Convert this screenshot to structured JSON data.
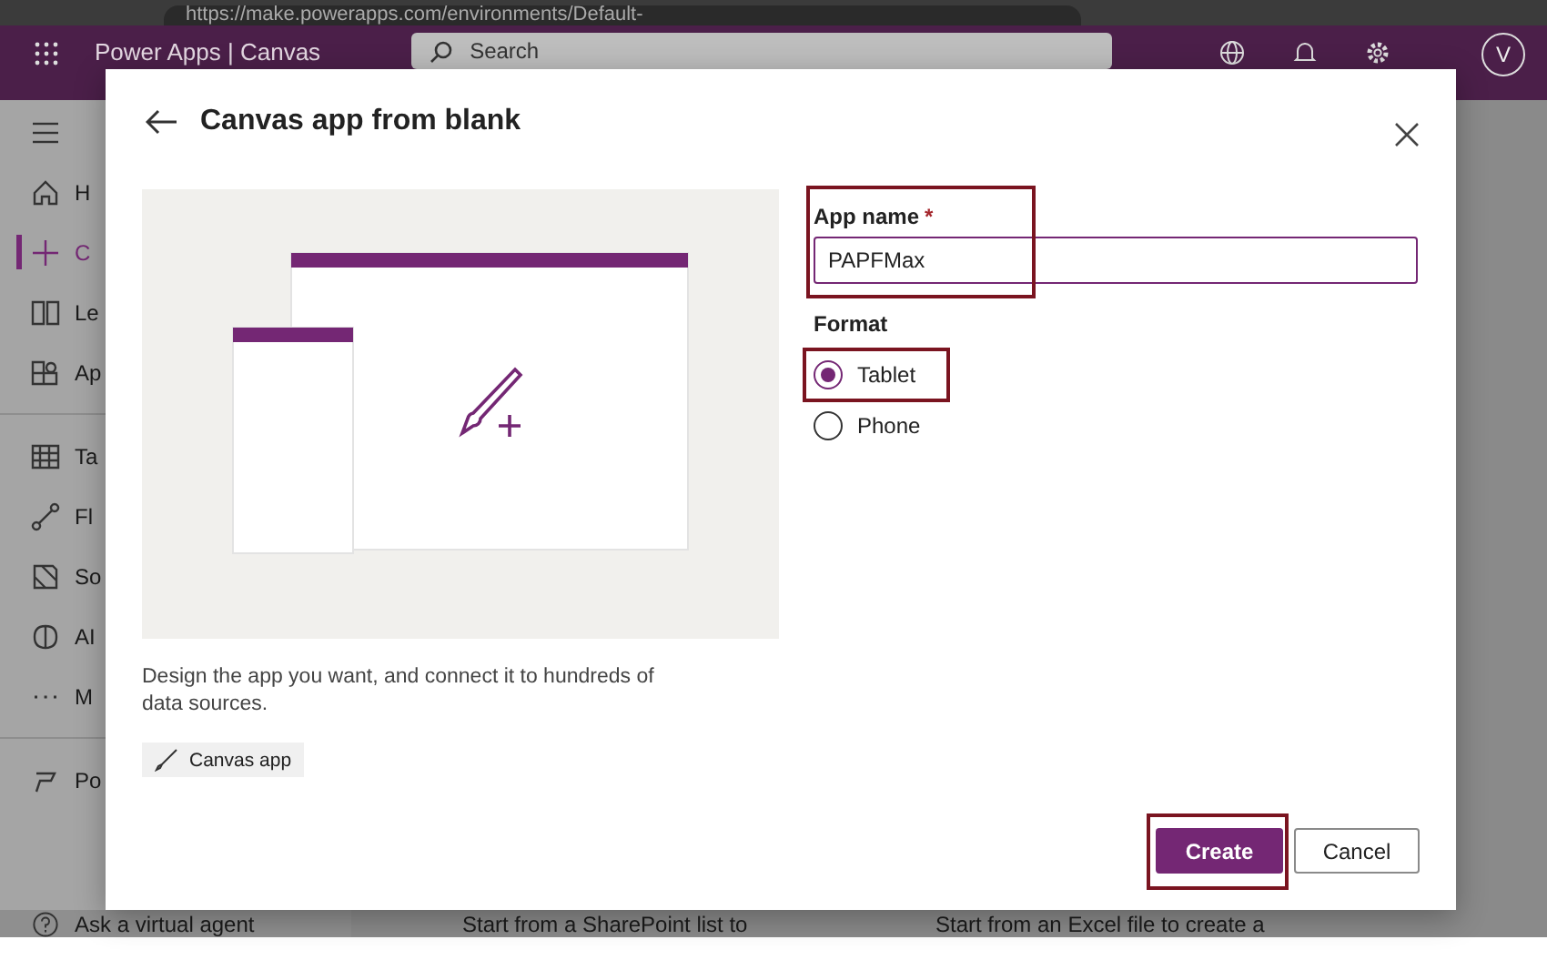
{
  "browser": {
    "url": "https://make.powerapps.com/environments/Default-"
  },
  "header": {
    "app_title": "Power Apps | Canvas",
    "search": {
      "placeholder": "Search"
    },
    "avatar": "V"
  },
  "sidebar": {
    "items": [
      {
        "label": "H",
        "selected": false,
        "divider_before": false
      },
      {
        "label": "C",
        "selected": true,
        "divider_before": false
      },
      {
        "label": "Le",
        "selected": false,
        "divider_before": false
      },
      {
        "label": "Ap",
        "selected": false,
        "divider_before": false
      },
      {
        "label": "Ta",
        "selected": false,
        "divider_before": true
      },
      {
        "label": "Fl",
        "selected": false,
        "divider_before": false
      },
      {
        "label": "So",
        "selected": false,
        "divider_before": false
      },
      {
        "label": "AI",
        "selected": false,
        "divider_before": false
      },
      {
        "label": "M",
        "selected": false,
        "divider_before": false
      },
      {
        "label": "Po",
        "selected": false,
        "divider_before": true
      }
    ],
    "footer": "Ask a virtual agent"
  },
  "background_cards": [
    "Start from a SharePoint list to",
    "Start from an Excel file to create a"
  ],
  "dialog": {
    "title": "Canvas app from blank",
    "description": "Design the app you want, and connect it to hundreds of data sources.",
    "tag": "Canvas app",
    "app_name": {
      "label": "App name",
      "required_mark": "*",
      "value": "PAPFMax",
      "highlighted": true
    },
    "format": {
      "label": "Format",
      "options": [
        {
          "label": "Tablet",
          "selected": true,
          "highlighted": true
        },
        {
          "label": "Phone",
          "selected": false,
          "highlighted": false
        }
      ]
    },
    "buttons": [
      {
        "label": "Create",
        "kind": "primary",
        "highlighted": true
      },
      {
        "label": "Cancel",
        "kind": "secondary",
        "highlighted": false
      }
    ]
  }
}
